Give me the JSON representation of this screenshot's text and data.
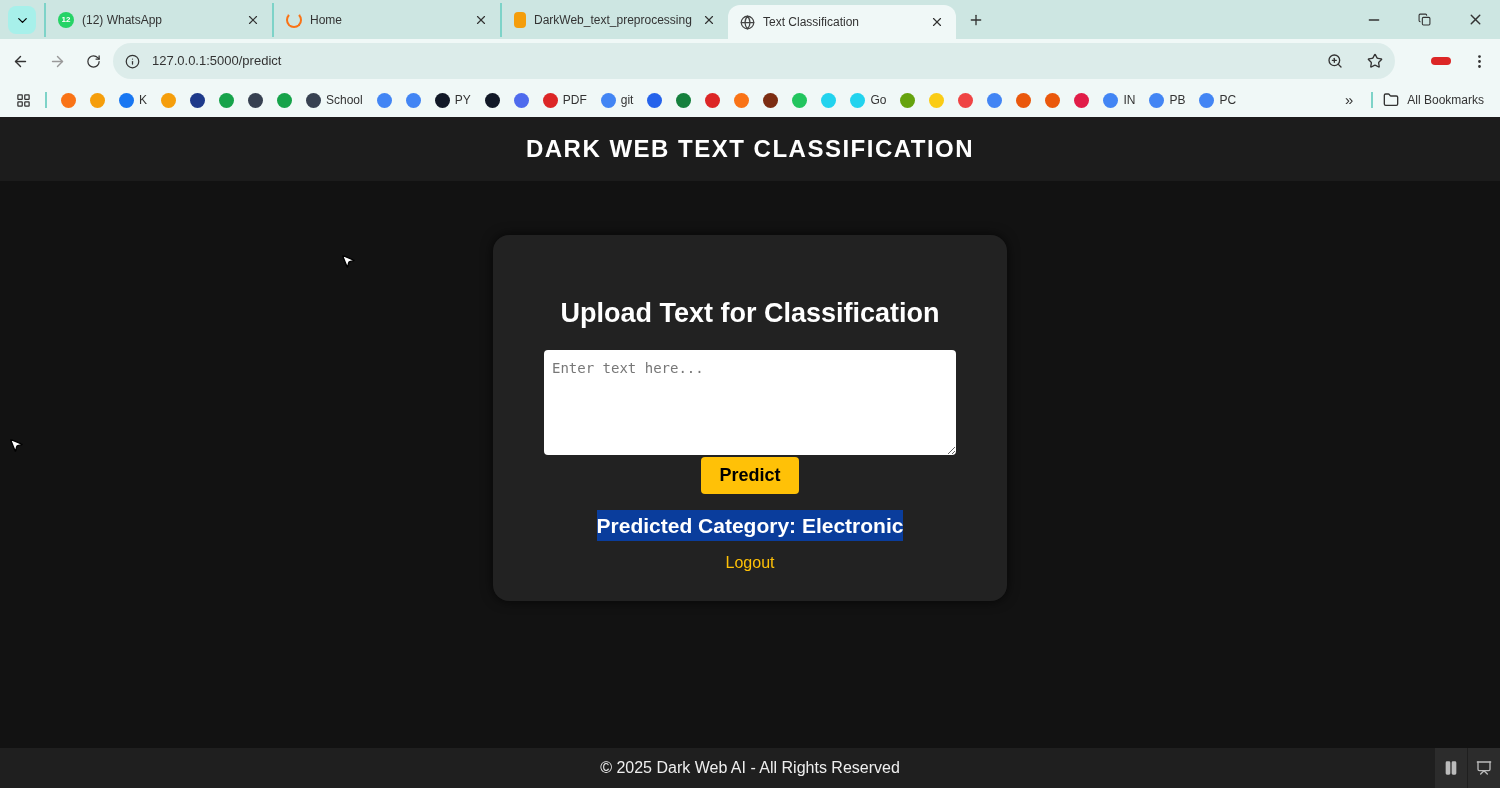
{
  "browser": {
    "tabs": [
      {
        "title": "(12) WhatsApp",
        "badge": "12",
        "kind": "chat",
        "selected": false
      },
      {
        "title": "Home",
        "kind": "ring",
        "selected": false
      },
      {
        "title": "DarkWeb_text_preprocessing",
        "kind": "notebook",
        "selected": false
      },
      {
        "title": "Text Classification",
        "kind": "globe",
        "selected": true
      }
    ],
    "url": "127.0.0.1:5000/predict",
    "bookmarks": [
      {
        "color": "#f97316"
      },
      {
        "color": "#f59e0b"
      },
      {
        "label": "K",
        "color": "#1877f2"
      },
      {
        "color": "#f59e0b"
      },
      {
        "color": "#1e3a8a"
      },
      {
        "color": "#16a34a"
      },
      {
        "color": "#374151"
      },
      {
        "color": "#16a34a"
      },
      {
        "label": "School",
        "color": "#374151"
      },
      {
        "color": "#4285f4"
      },
      {
        "color": "#4285f4"
      },
      {
        "label": "PY",
        "color": "#111827"
      },
      {
        "color": "#111827"
      },
      {
        "color": "#4f6bed"
      },
      {
        "label": "PDF",
        "color": "#dc2626"
      },
      {
        "label": "git",
        "color": "#4285f4"
      },
      {
        "color": "#2563eb"
      },
      {
        "color": "#15803d"
      },
      {
        "color": "#dc2626"
      },
      {
        "color": "#f97316"
      },
      {
        "color": "#7c2d12"
      },
      {
        "color": "#22c55e"
      },
      {
        "color": "#22d3ee"
      },
      {
        "label": "Go",
        "color": "#22d3ee"
      },
      {
        "color": "#65a30d"
      },
      {
        "color": "#facc15"
      },
      {
        "color": "#ef4444"
      },
      {
        "color": "#4285f4"
      },
      {
        "color": "#ea580c"
      },
      {
        "color": "#ea580c"
      },
      {
        "color": "#e11d48"
      },
      {
        "label": "IN",
        "color": "#4285f4"
      },
      {
        "label": "PB",
        "color": "#4285f4"
      },
      {
        "label": "PC",
        "color": "#4285f4"
      }
    ],
    "overflow": "»",
    "all_bookmarks": "All Bookmarks"
  },
  "page": {
    "header": "DARK WEB TEXT CLASSIFICATION",
    "card": {
      "heading": "Upload Text for Classification",
      "textarea": {
        "placeholder": "Enter text here..."
      },
      "button": "Predict",
      "result": "Predicted Category: Electronic",
      "result_highlighted": true,
      "link": "Logout"
    },
    "footer": "© 2025 Dark Web AI - All Rights Reserved"
  }
}
